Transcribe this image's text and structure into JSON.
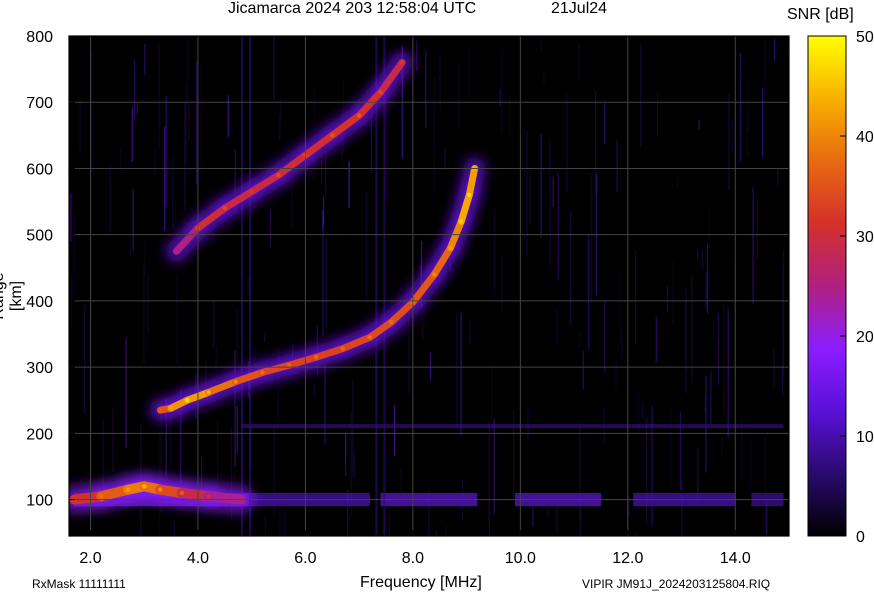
{
  "header": {
    "title": "Jicamarca 2024 203 12:58:04 UTC",
    "date": "21Jul24"
  },
  "footer": {
    "rxmask": "RxMask 11111111",
    "filename": "VIPIR  JM91J_2024203125804.RIQ"
  },
  "colors": {
    "background": "#000000",
    "gridline": "#444444",
    "colormap": [
      "#000000",
      "#2a0a6e",
      "#5a10d8",
      "#8c1cff",
      "#b02080",
      "#d4302a",
      "#e86a10",
      "#f8b000",
      "#ffff00"
    ]
  },
  "chart_data": {
    "type": "heatmap",
    "xlabel": "Frequency [MHz]",
    "ylabel": "Range [km]",
    "colorbar_label": "SNR [dB]",
    "xlim": [
      1.6,
      15.0
    ],
    "ylim": [
      45,
      800
    ],
    "x_ticks": [
      "2.0",
      "4.0",
      "6.0",
      "8.0",
      "10.0",
      "12.0",
      "14.0"
    ],
    "x_tick_values": [
      2,
      4,
      6,
      8,
      10,
      12,
      14
    ],
    "y_ticks": [
      "100",
      "200",
      "300",
      "400",
      "500",
      "600",
      "700",
      "800"
    ],
    "y_tick_values": [
      100,
      200,
      300,
      400,
      500,
      600,
      700,
      800
    ],
    "colorbar_ticks": [
      "0",
      "10",
      "20",
      "30",
      "40",
      "50"
    ],
    "colorbar_tick_values": [
      0,
      10,
      20,
      30,
      40,
      50
    ],
    "clim": [
      0,
      50
    ],
    "grid": true,
    "traces": [
      {
        "name": "",
        "x": [
          3.3,
          3.5,
          3.8,
          4.2,
          4.7,
          5.2,
          5.7,
          6.2,
          6.7,
          7.2,
          7.6,
          8.0,
          8.4,
          8.7,
          8.9,
          9.05,
          9.15
        ],
        "y": [
          235,
          238,
          250,
          262,
          278,
          292,
          303,
          315,
          328,
          345,
          368,
          398,
          440,
          480,
          520,
          560,
          600
        ],
        "snr": [
          32,
          38,
          44,
          40,
          36,
          34,
          33,
          33,
          33,
          34,
          34,
          35,
          36,
          38,
          42,
          44,
          40
        ]
      },
      {
        "name": "",
        "x": [
          3.6,
          4.0,
          4.5,
          5.0,
          5.5,
          6.0,
          6.5,
          7.0,
          7.4,
          7.8
        ],
        "y": [
          475,
          510,
          540,
          565,
          590,
          620,
          650,
          680,
          715,
          760
        ],
        "snr": [
          20,
          30,
          30,
          28,
          30,
          30,
          31,
          32,
          30,
          28
        ]
      },
      {
        "name": "",
        "x": [
          1.7,
          2.2,
          2.7,
          3.0,
          3.3,
          3.7,
          4.2,
          4.8
        ],
        "y": [
          100,
          105,
          115,
          120,
          115,
          110,
          105,
          100
        ],
        "snr": [
          28,
          34,
          38,
          40,
          36,
          32,
          26,
          22
        ]
      }
    ]
  }
}
